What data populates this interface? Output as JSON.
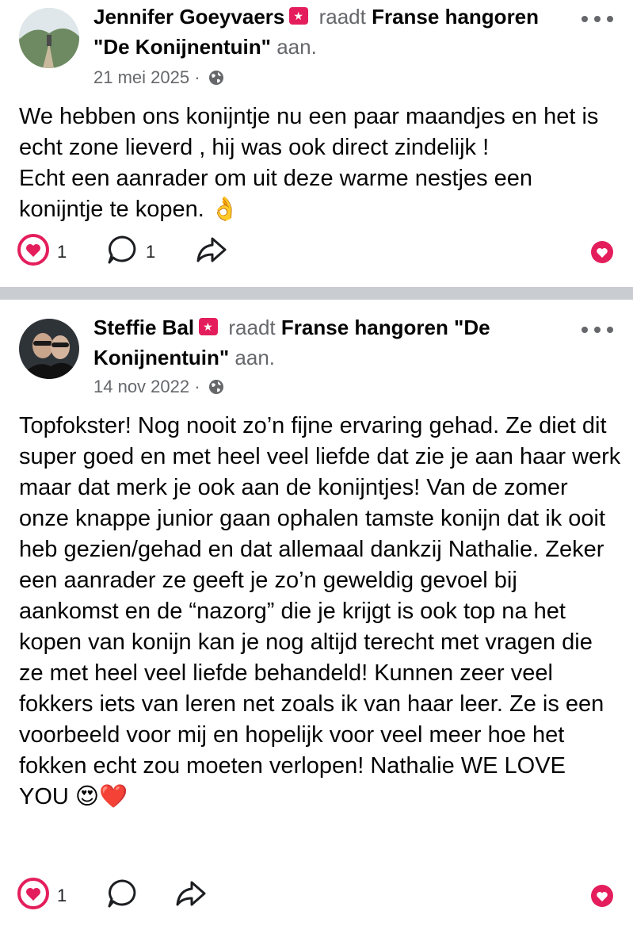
{
  "posts": [
    {
      "author": "Jennifer Goeyvaers",
      "verb": "raadt",
      "page": "Franse hangoren \"De Konijnentuin\"",
      "suffix": "aan.",
      "date": "21 mei 2025",
      "text": "We hebben ons konijntje nu een paar maandjes en het is echt zone lieverd , hij was ook direct zindelijk !\nEcht een aanrader om uit deze warme nestjes een konijntje te kopen. 👌",
      "reactions": "1",
      "comments": "1"
    },
    {
      "author": "Steffie Bal",
      "verb": "raadt",
      "page": "Franse hangoren \"De Konijnentuin\"",
      "suffix": "aan.",
      "date": "14 nov 2022",
      "text": "Topfokster! Nog nooit zo’n fijne ervaring gehad. Ze diet dit super goed en met heel veel liefde dat zie je aan haar werk maar dat merk je ook aan de konijntjes! Van de zomer onze knappe junior gaan ophalen tamste konijn dat ik ooit heb gezien/gehad en dat allemaal dankzij Nathalie. Zeker een aanrader ze geeft je zo’n geweldig gevoel bij aankomst en de “nazorg” die je krijgt is ook top na het kopen van konijn kan je nog altijd terecht met vragen die ze met heel veel liefde behandeld! Kunnen zeer veel fokkers iets van leren net zoals ik van haar leer. Ze is een voorbeeld voor mij en hopelijk voor veel meer hoe het fokken echt zou moeten verlopen! Nathalie WE LOVE YOU 😍❤️",
      "reactions": "1"
    }
  ],
  "colors": {
    "accent": "#e41e5c",
    "secondary_text": "#65676b",
    "divider": "#c9ccd1"
  },
  "icons": [
    "globe-icon",
    "more-options-icon",
    "heart-reaction-icon",
    "comment-icon",
    "share-icon"
  ]
}
